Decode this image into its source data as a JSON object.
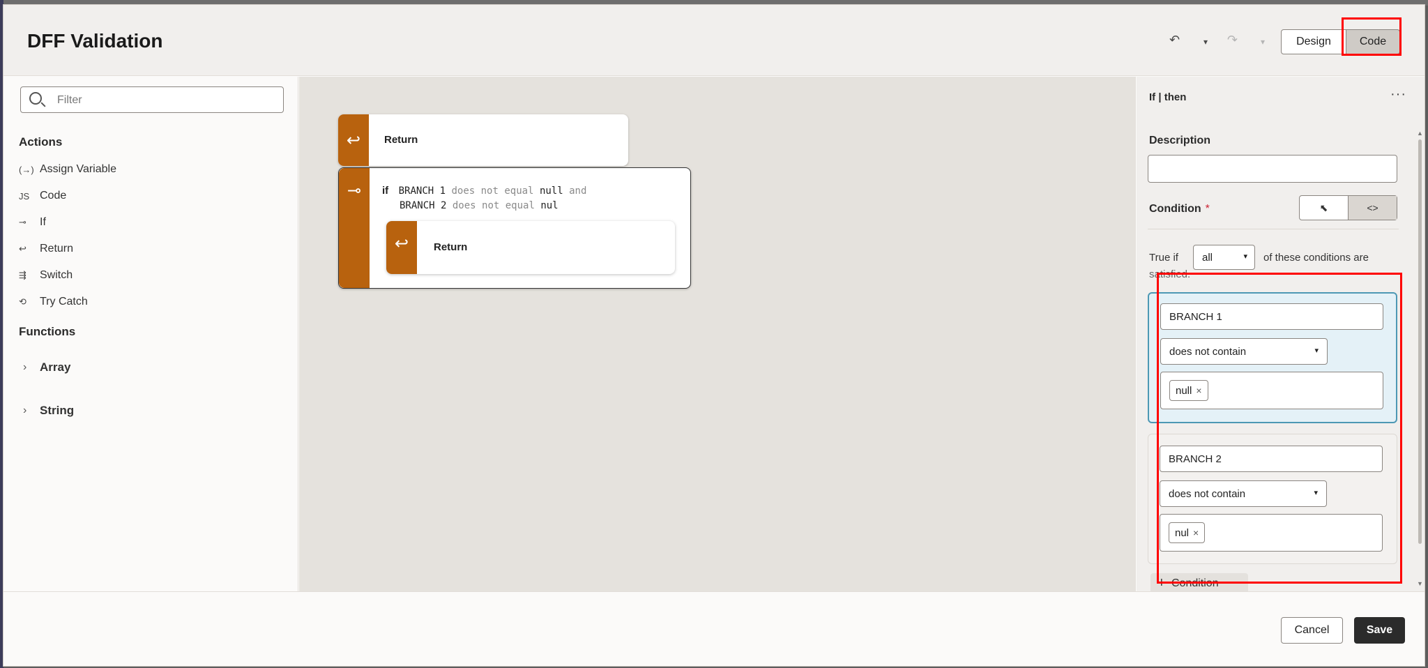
{
  "dialog": {
    "title": "DFF Validation",
    "undo_icon": "↶",
    "redo_icon": "↷",
    "caret": "▾",
    "design_label": "Design",
    "code_label": "Code"
  },
  "left_panel": {
    "filter_placeholder": "Filter",
    "actions_heading": "Actions",
    "actions": [
      {
        "icon": "(→)",
        "label": "Assign Variable"
      },
      {
        "icon": "JS",
        "label": "Code"
      },
      {
        "icon": "⊸",
        "label": "If"
      },
      {
        "icon": "↩",
        "label": "Return"
      },
      {
        "icon": "⇶",
        "label": "Switch"
      },
      {
        "icon": "⟲",
        "label": "Try Catch"
      }
    ],
    "functions_heading": "Functions",
    "groups": [
      {
        "icon": "›",
        "label": "Array"
      },
      {
        "icon": "›",
        "label": "String"
      }
    ]
  },
  "canvas": {
    "return_icon": "↩",
    "branch_icon": "⊸",
    "return1_label": "Return",
    "if_keyword": "if",
    "cond1_field": "BRANCH 1",
    "cond1_op": "does not equal",
    "cond1_value": "null",
    "cond1_join": "and",
    "cond2_field": "BRANCH 2",
    "cond2_op": "does not equal",
    "cond2_value": "nul",
    "return2_label": "Return"
  },
  "right_panel": {
    "title": "If | then",
    "more": "···",
    "description_label": "Description",
    "description_value": "",
    "condition_label": "Condition",
    "required_mark": "*",
    "mode_pick": "⬉",
    "mode_code": "<>",
    "true_if": "True if",
    "match_mode": "all",
    "rest_text": "of these conditions are",
    "satisfied": "satisfied.",
    "conditions": [
      {
        "field": "BRANCH 1",
        "operator": "does not contain",
        "chip": "null"
      },
      {
        "field": "BRANCH 2",
        "operator": "does not contain",
        "chip": "nul"
      }
    ],
    "chip_remove": "×",
    "add_condition": "Condition",
    "scroll_up": "▲",
    "scroll_down": "▼"
  },
  "footer": {
    "cancel_label": "Cancel",
    "save_label": "Save"
  },
  "colors": {
    "accent_orange": "#b8620e",
    "selected_border": "#4d98b4",
    "highlight": "#ff0000"
  }
}
